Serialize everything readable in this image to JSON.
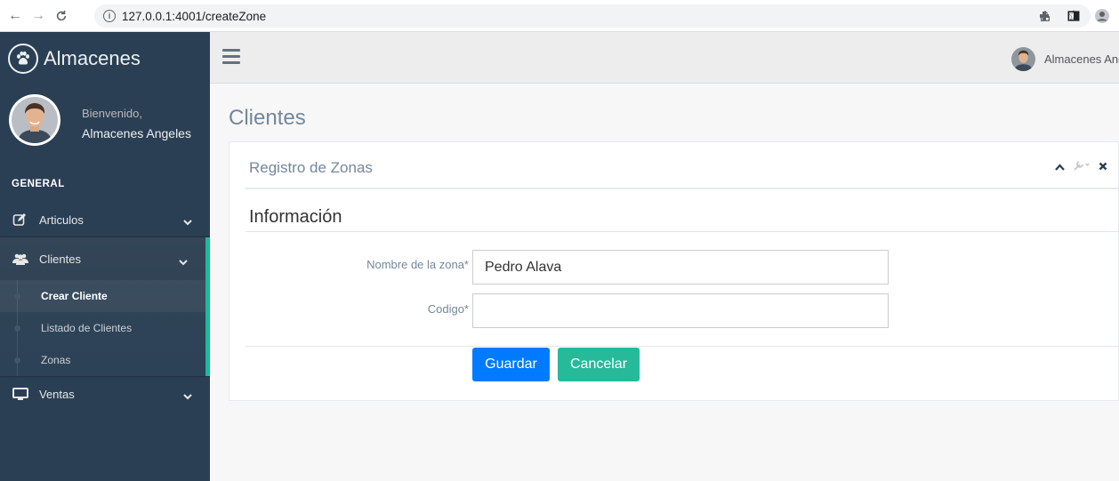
{
  "browser": {
    "url": "127.0.0.1:4001/createZone"
  },
  "sidebar": {
    "brand": "Almacenes",
    "welcome": "Bienvenido,",
    "user_name": "Almacenes Angeles",
    "section": "GENERAL",
    "items": [
      {
        "label": "Articulos",
        "icon": "edit-icon"
      },
      {
        "label": "Clientes",
        "icon": "users-icon",
        "children": [
          "Crear Cliente",
          "Listado de Clientes",
          "Zonas"
        ]
      },
      {
        "label": "Ventas",
        "icon": "desktop-icon"
      }
    ]
  },
  "topnav": {
    "user_name": "Almacenes Angeles"
  },
  "main": {
    "page_title": "Clientes",
    "panel_title": "Registro de Zonas",
    "legend": "Información",
    "fields": [
      {
        "label": "Nombre de la zona*",
        "value": "Pedro Alava"
      },
      {
        "label": "Codigo*",
        "value": ""
      }
    ],
    "save_label": "Guardar",
    "cancel_label": "Cancelar"
  },
  "colors": {
    "sidebar": "#2A3F54",
    "accent": "#1ABB9C",
    "primary": "#007BFF",
    "success": "#26B99A"
  }
}
